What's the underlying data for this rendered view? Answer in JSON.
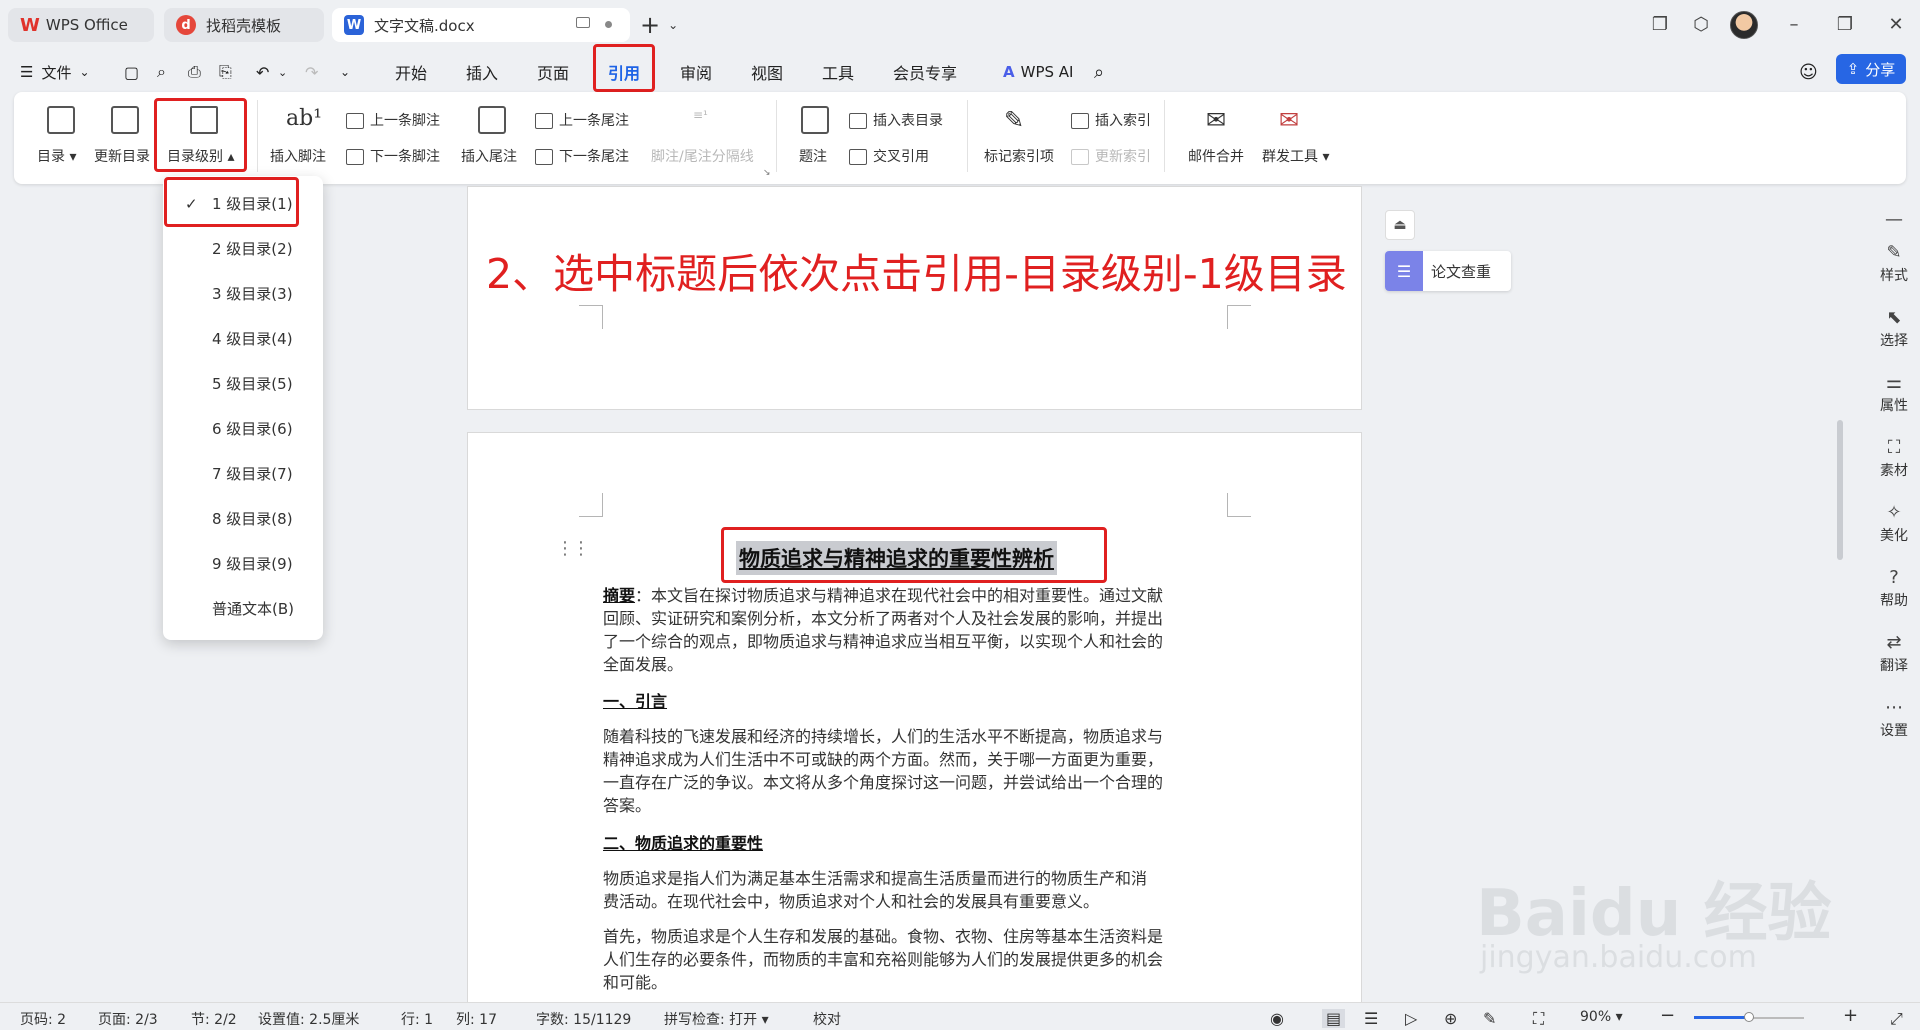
{
  "tabs": [
    {
      "label": "WPS Office"
    },
    {
      "label": "找稻壳模板"
    },
    {
      "label": "文字文稿.docx"
    }
  ],
  "menu": {
    "file": "文件",
    "items": [
      "开始",
      "插入",
      "页面",
      "引用",
      "审阅",
      "视图",
      "工具",
      "会员专享"
    ],
    "wps_ai": "WPS AI",
    "share": "分享"
  },
  "ribbon": {
    "toc": "目录",
    "update_toc": "更新目录",
    "toc_level": "目录级别",
    "insert_footnote": "插入脚注",
    "prev_footnote": "上一条脚注",
    "next_footnote": "下一条脚注",
    "insert_endnote": "插入尾注",
    "prev_endnote": "上一条尾注",
    "next_endnote": "下一条尾注",
    "separator": "脚注/尾注分隔线",
    "caption": "题注",
    "insert_table_of_figures": "插入表目录",
    "cross_reference": "交叉引用",
    "mark_index": "标记索引项",
    "insert_index": "插入索引",
    "update_index": "更新索引",
    "mail_merge": "邮件合并",
    "bulk_send": "群发工具"
  },
  "dropdown": {
    "items": [
      "1 级目录(1)",
      "2 级目录(2)",
      "3 级目录(3)",
      "4 级目录(4)",
      "5 级目录(5)",
      "6 级目录(6)",
      "7 级目录(7)",
      "8 级目录(8)",
      "9 级目录(9)",
      "普通文本(B)"
    ],
    "checked": "1 级目录(1)"
  },
  "annotation": "2、选中标题后依次点击引用-目录级别-1级目录",
  "document": {
    "title": "物质追求与精神追求的重要性辨析",
    "abstract_label": "摘要",
    "abstract_lines": [
      "：本文旨在探讨物质追求与精神追求在现代社会中的相对重要性。通过文献",
      "回顾、实证研究和案例分析，本文分析了两者对个人及社会发展的影响，并提出",
      "了一个综合的观点，即物质追求与精神追求应当相互平衡，以实现个人和社会的",
      "全面发展。"
    ],
    "h1": "一、引言",
    "p1_lines": [
      "随着科技的飞速发展和经济的持续增长，人们的生活水平不断提高，物质追求与",
      "精神追求成为人们生活中不可或缺的两个方面。然而，关于哪一方面更为重要，",
      "一直存在广泛的争议。本文将从多个角度探讨这一问题，并尝试给出一个合理的",
      "答案。"
    ],
    "h2": "二、物质追求的重要性",
    "p2_lines": [
      "物质追求是指人们为满足基本生活需求和提高生活质量而进行的物质生产和消",
      "费活动。在现代社会中，物质追求对个人和社会的发展具有重要意义。"
    ],
    "p3_lines": [
      "首先，物质追求是个人生存和发展的基础。食物、衣物、住房等基本生活资料是",
      "人们生存的必要条件，而物质的丰富和充裕则能够为人们的发展提供更多的机会",
      "和可能。"
    ]
  },
  "right_panel": {
    "essay_check": "论文查重"
  },
  "sidebar": [
    "样式",
    "选择",
    "属性",
    "素材",
    "美化",
    "帮助",
    "翻译",
    "设置"
  ],
  "status": {
    "page": "页码: 2",
    "pages": "页面: 2/3",
    "section": "节: 2/2",
    "setting": "设置值: 2.5厘米",
    "row": "行: 1",
    "col": "列: 17",
    "words": "字数: 15/1129",
    "spell": "拼写检查: 打开",
    "proof": "校对",
    "zoom": "90%",
    "zoom_level": 0.5
  },
  "watermark": {
    "brand": "Bai",
    "brand2": "du",
    "brand3": "经验",
    "url": "jingyan.baidu.com"
  },
  "colors": {
    "accent": "#1e63e6",
    "highlight": "#e02020"
  }
}
